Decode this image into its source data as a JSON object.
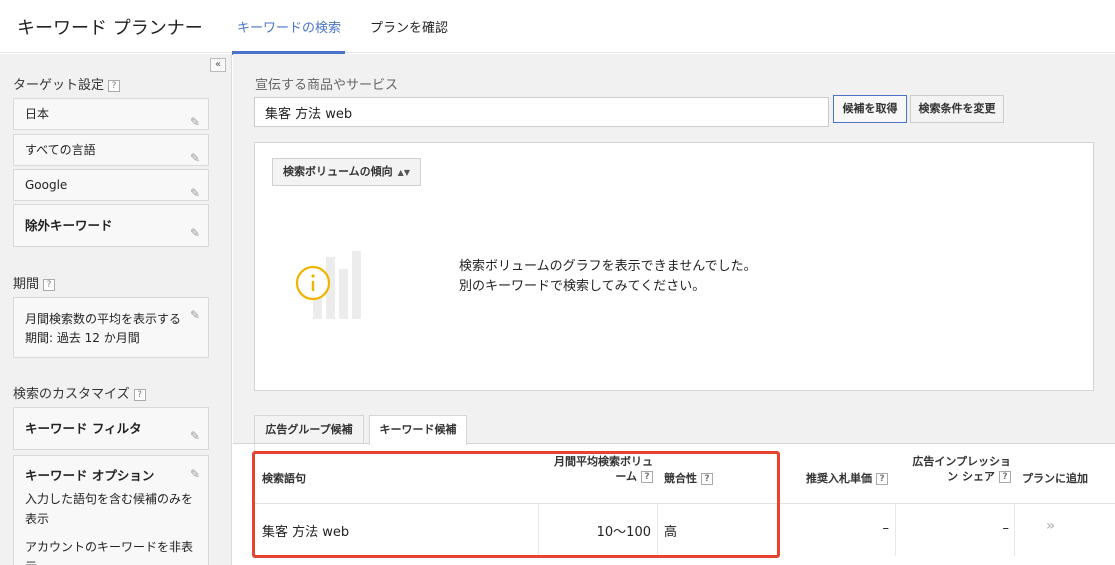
{
  "header": {
    "title": "キーワード プランナー",
    "tabs": [
      {
        "label": "キーワードの検索",
        "active": true
      },
      {
        "label": "プランを確認",
        "active": false
      }
    ]
  },
  "sidebar": {
    "collapse_glyph": "«",
    "targeting": {
      "title": "ターゲット設定",
      "help": "?",
      "items": [
        {
          "label": "日本"
        },
        {
          "label": "すべての言語"
        },
        {
          "label": "Google"
        },
        {
          "label": "除外キーワード"
        }
      ]
    },
    "period": {
      "title": "期間",
      "help": "?",
      "line1": "月間検索数の平均を表示する",
      "line2": "期間: 過去 12 か月間"
    },
    "customize": {
      "title": "検索のカスタマイズ",
      "help": "?",
      "filter_label": "キーワード フィルタ",
      "options_label": "キーワード オプション",
      "option1a": "入力した語句を含む候補のみを",
      "option1b": "表示",
      "option2a": "アカウントのキーワードを非表",
      "option2b": "示"
    }
  },
  "main": {
    "field_label": "宣伝する商品やサービス",
    "search_value": "集客 方法 web",
    "get_ideas_button": "候補を取得",
    "modify_search_button": "検索条件を変更",
    "trend_dropdown": "検索ボリュームの傾向",
    "empty_line1": "検索ボリュームのグラフを表示できませんでした。",
    "empty_line2": "別のキーワードで検索してみてください。",
    "result_tabs": [
      {
        "label": "広告グループ候補",
        "active": false
      },
      {
        "label": "キーワード候補",
        "active": true
      }
    ],
    "table": {
      "headers": {
        "keyword": "検索語句",
        "volume_1": "月間平均検索ボリュ",
        "volume_2": "ーム",
        "competition": "競合性",
        "bid": "推奨入札単価",
        "share_1": "広告インプレッショ",
        "share_2": "ン シェア",
        "add": "プランに追加",
        "help": "?"
      },
      "rows": [
        {
          "keyword": "集客 方法 web",
          "volume": "10〜100",
          "competition": "高",
          "bid": "–",
          "share": "–",
          "add": "»"
        }
      ]
    }
  },
  "colors": {
    "accent": "#4a73c9",
    "highlight": "#e8432f",
    "info_icon": "#f0b400"
  }
}
